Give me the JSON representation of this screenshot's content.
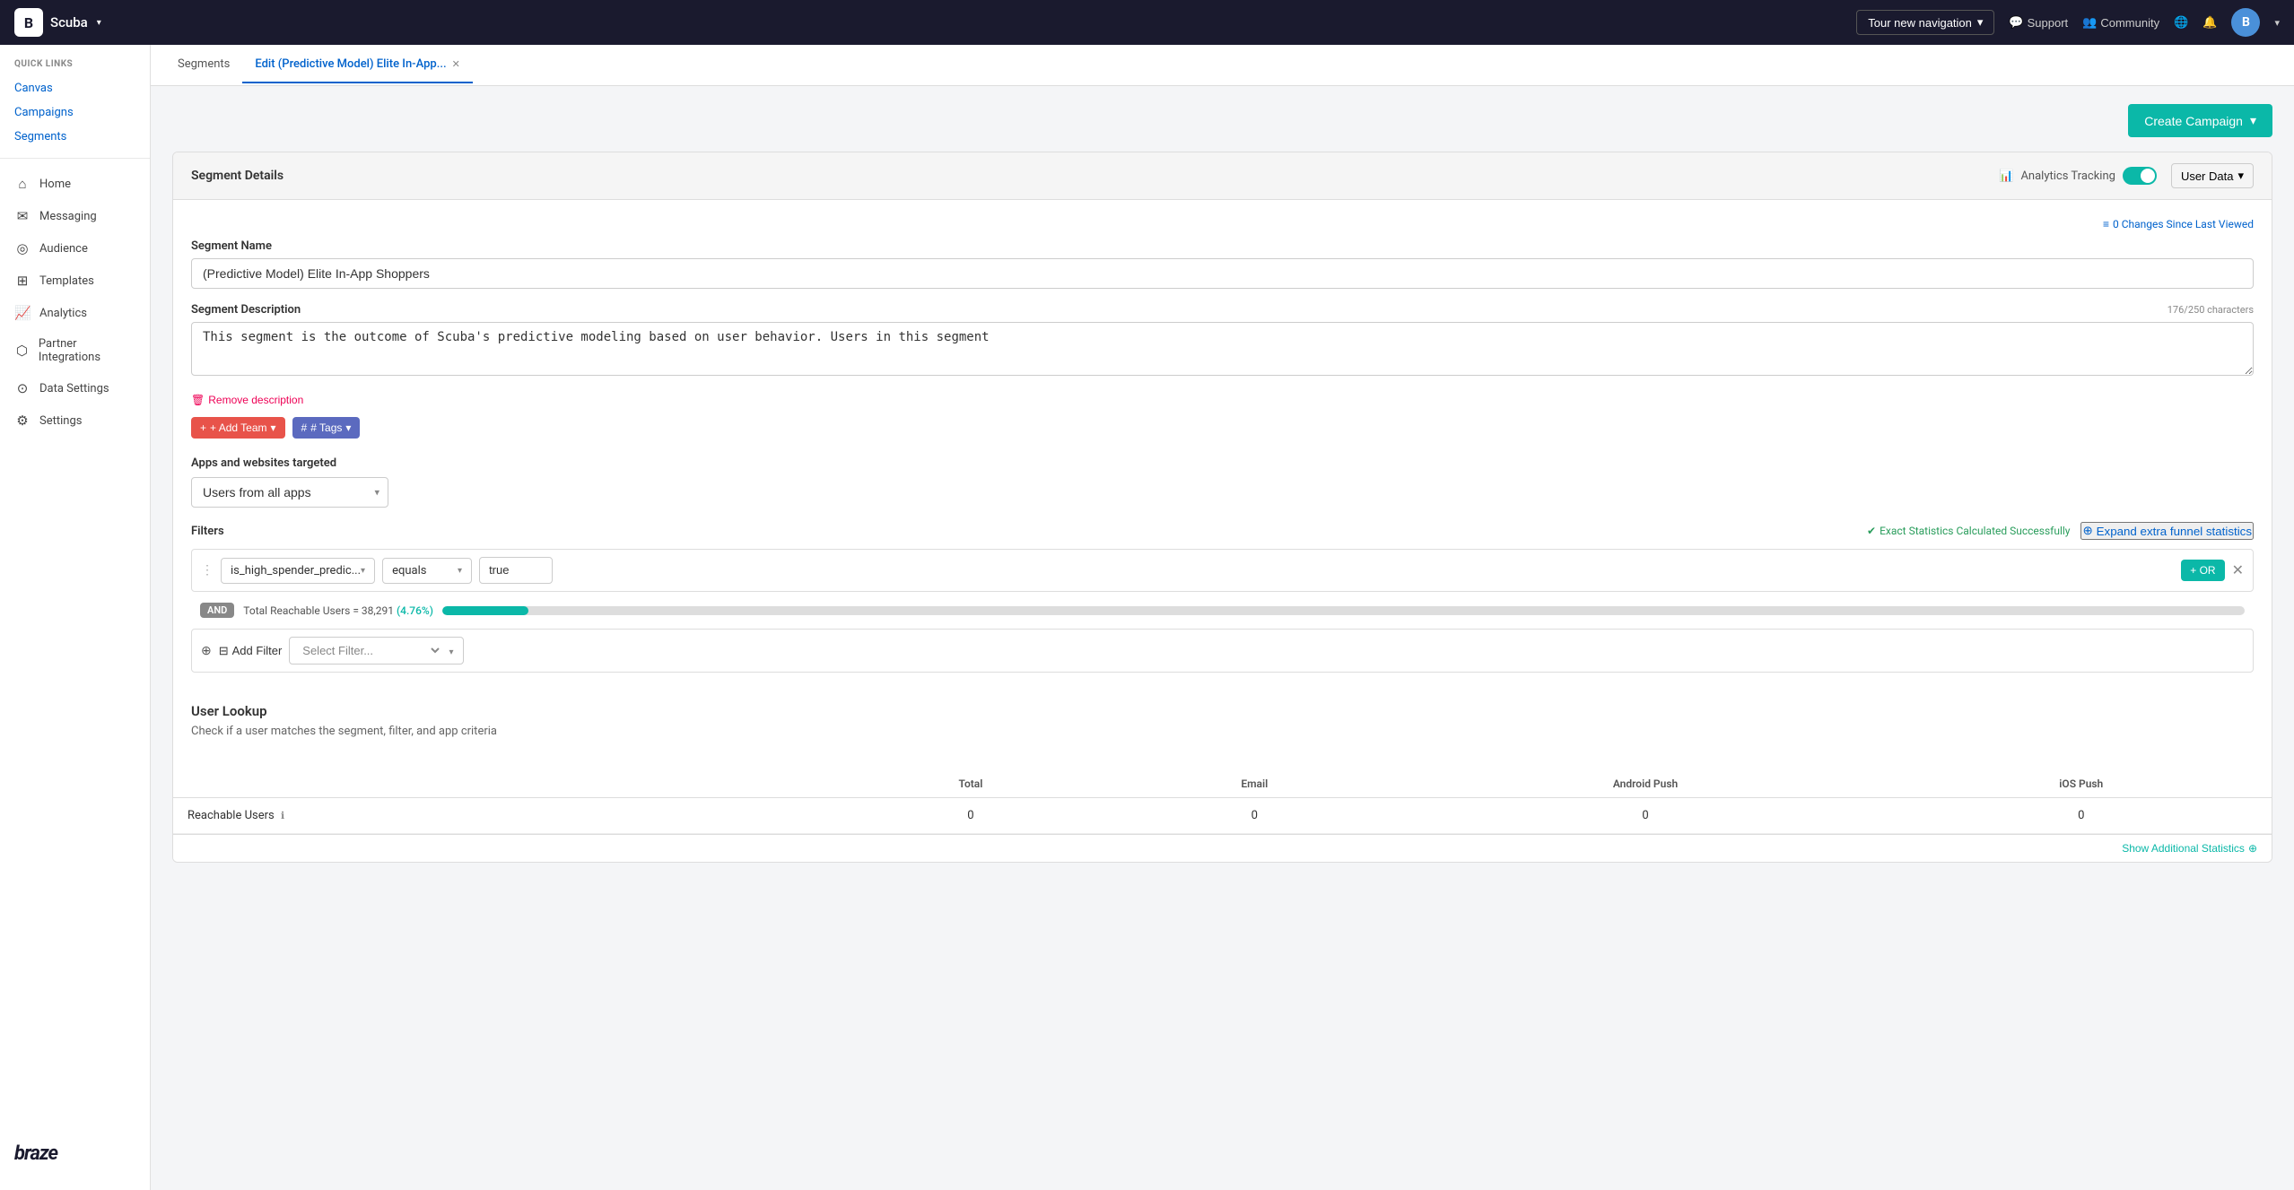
{
  "topNav": {
    "brand": "Scuba",
    "tourBtn": "Tour new navigation",
    "supportLabel": "Support",
    "communityLabel": "Community",
    "avatarInitial": "B"
  },
  "sidebar": {
    "quickLinksLabel": "QUICK LINKS",
    "quickLinks": [
      {
        "id": "canvas",
        "label": "Canvas"
      },
      {
        "id": "campaigns",
        "label": "Campaigns"
      },
      {
        "id": "segments",
        "label": "Segments"
      }
    ],
    "navItems": [
      {
        "id": "home",
        "label": "Home",
        "icon": "⌂"
      },
      {
        "id": "messaging",
        "label": "Messaging",
        "icon": "✉"
      },
      {
        "id": "audience",
        "label": "Audience",
        "icon": "👥"
      },
      {
        "id": "templates",
        "label": "Templates",
        "icon": "⊞"
      },
      {
        "id": "analytics",
        "label": "Analytics",
        "icon": "📈"
      },
      {
        "id": "partner-integrations",
        "label": "Partner Integrations",
        "icon": "🔗"
      },
      {
        "id": "data-settings",
        "label": "Data Settings",
        "icon": "⚙"
      },
      {
        "id": "settings",
        "label": "Settings",
        "icon": "⚙"
      }
    ],
    "logo": "braze"
  },
  "tabs": [
    {
      "id": "segments",
      "label": "Segments",
      "active": false
    },
    {
      "id": "edit-segment",
      "label": "Edit (Predictive Model) Elite In-App...",
      "active": true,
      "closable": true
    }
  ],
  "toolbar": {
    "createCampaignLabel": "Create Campaign"
  },
  "segmentDetails": {
    "cardTitle": "Segment Details",
    "analyticsTrackingLabel": "Analytics Tracking",
    "userDataLabel": "User Data",
    "changesLabel": "0 Changes Since Last Viewed",
    "segmentNameLabel": "Segment Name",
    "segmentNameValue": "(Predictive Model) Elite In-App Shoppers",
    "segmentDescriptionLabel": "Segment Description",
    "charCount": "176/250 characters",
    "descriptionValue": "This segment is the outcome of Scuba's predictive modeling based on user behavior. Users in this segment",
    "removeDescriptionLabel": "Remove description",
    "addTeamLabel": "+ Add Team",
    "tagsLabel": "# Tags",
    "appsTargetedLabel": "Apps and websites targeted",
    "appsTargetedValue": "Users from all apps",
    "filtersLabel": "Filters",
    "exactStatsLabel": "Exact Statistics Calculated Successfully",
    "expandStatsLabel": "Expand extra funnel statistics",
    "filterField": "is_high_spender_predic...",
    "filterOp": "equals",
    "filterVal": "true",
    "orLabel": "+ OR",
    "andBadge": "AND",
    "reachableText": "Total Reachable Users = 38,291",
    "reachablePct": "(4.76%)",
    "progressPct": 4.76,
    "addFilterLabel": "Add Filter",
    "selectFilterPlaceholder": "Select Filter..."
  },
  "userLookup": {
    "title": "User Lookup",
    "subtitle": "Check if a user matches the segment, filter, and app criteria"
  },
  "statsTable": {
    "columns": [
      "",
      "Total",
      "Email",
      "Android Push",
      "iOS Push"
    ],
    "rows": [
      {
        "label": "Reachable Users",
        "total": "0",
        "email": "0",
        "androidPush": "0",
        "iosPush": "0"
      }
    ]
  },
  "footer": {
    "showAdditionalStats": "Show Additional Statistics"
  }
}
